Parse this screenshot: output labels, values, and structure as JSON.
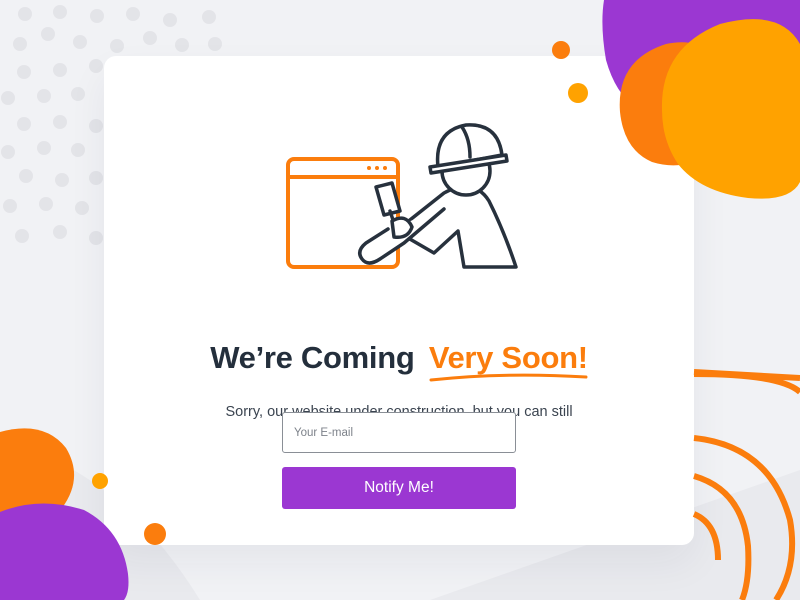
{
  "headline": {
    "main": "We’re Coming",
    "accent": "Very Soon!"
  },
  "subtitle": "Sorry, our website under construction, but you can still subscribe to our updates.",
  "email": {
    "placeholder": "Your E-mail",
    "value": ""
  },
  "notify_button": "Notify Me!",
  "illustration": {
    "icons": [
      "browser-window-icon",
      "construction-worker-icon",
      "hard-hat-icon",
      "paint-roller-icon"
    ]
  },
  "colors": {
    "accent_orange": "#fb7d0d",
    "accent_yellow": "#ffa200",
    "accent_purple": "#9b37d2",
    "heading": "#242f3c",
    "background": "#f1f2f5"
  }
}
